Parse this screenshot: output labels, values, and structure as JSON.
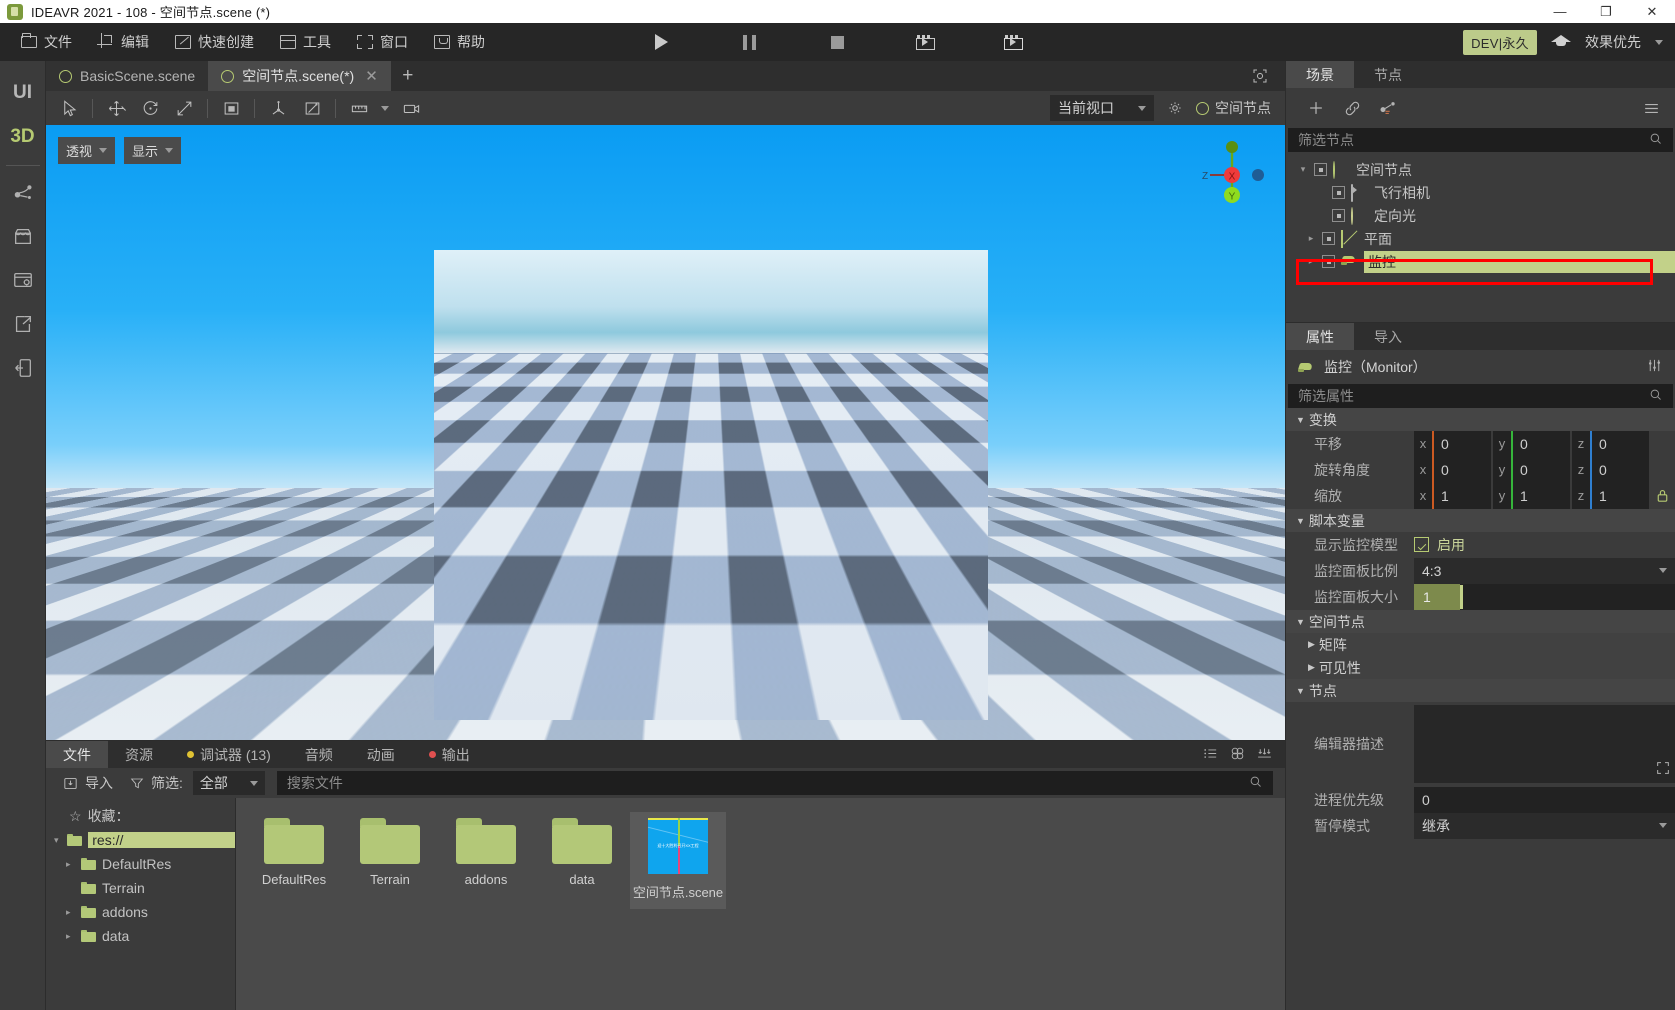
{
  "window": {
    "title": "IDEAVR 2021 - 108 - 空间节点.scene (*)",
    "minimize": "—",
    "maximize": "❐",
    "close": "✕"
  },
  "menubar": {
    "items": [
      {
        "label": "文件",
        "icon": "folder-icon"
      },
      {
        "label": "编辑",
        "icon": "crop-icon"
      },
      {
        "label": "快速创建",
        "icon": "pencil-square-icon"
      },
      {
        "label": "工具",
        "icon": "window-icon"
      },
      {
        "label": "窗口",
        "icon": "corners-icon"
      },
      {
        "label": "帮助",
        "icon": "book-icon"
      }
    ],
    "transport": [
      {
        "name": "play-button",
        "icon": "play-icon"
      },
      {
        "name": "pause-button",
        "icon": "pause-icon"
      },
      {
        "name": "stop-button",
        "icon": "stop-icon"
      },
      {
        "name": "play-scene-button",
        "icon": "film-play-icon"
      },
      {
        "name": "play-custom-scene-button",
        "icon": "film-play-alt-icon"
      }
    ],
    "dev_badge": "DEV|永久",
    "grad_cap_icon": "graduation-cap-icon",
    "render_mode": "效果优先"
  },
  "rail": {
    "modes": [
      {
        "label": "UI",
        "active": false
      },
      {
        "label": "3D",
        "active": true
      }
    ],
    "icons": [
      "node-graph-icon",
      "store-icon",
      "browser-settings-icon",
      "export-share-icon",
      "import-device-icon"
    ]
  },
  "scene_tabs": {
    "tabs": [
      {
        "label": "BasicScene.scene",
        "active": false,
        "closable": false
      },
      {
        "label": "空间节点.scene(*)",
        "active": true,
        "closable": true
      }
    ],
    "close_glyph": "✕",
    "add_glyph": "+",
    "expand_icon": "expand-viewport-icon"
  },
  "viewport_toolbar": {
    "tools": [
      {
        "name": "select-tool",
        "icon": "cursor-icon"
      },
      {
        "name": "move-tool",
        "icon": "move-icon"
      },
      {
        "name": "rotate-tool",
        "icon": "rotate-icon"
      },
      {
        "name": "scale-tool",
        "icon": "scale-icon"
      },
      {
        "name": "list-select-tool",
        "icon": "box-select-icon"
      },
      {
        "name": "local-space-tool",
        "icon": "axis-icon"
      },
      {
        "name": "snap-tool",
        "icon": "snap-icon"
      },
      {
        "name": "ruler-tool",
        "icon": "ruler-icon"
      },
      {
        "name": "camera-tool",
        "icon": "camera-icon"
      }
    ],
    "viewport_select": "当前视口",
    "settings_icon": "gear-icon",
    "node_label": "空间节点"
  },
  "viewport": {
    "perspective_label": "透视",
    "display_label": "显示",
    "gizmo": {
      "x": "X",
      "y": "Y",
      "z": "Z",
      "x_color": "#ef3b3b",
      "y_color": "#8fdb1f",
      "z_color": "#1f6fb5"
    }
  },
  "bottom_dock": {
    "tabs": [
      {
        "label": "文件",
        "active": true,
        "dot": null
      },
      {
        "label": "资源",
        "active": false,
        "dot": null
      },
      {
        "label": "调试器 (13)",
        "active": false,
        "dot": "#e0c233"
      },
      {
        "label": "音频",
        "active": false,
        "dot": null
      },
      {
        "label": "动画",
        "active": false,
        "dot": null
      },
      {
        "label": "输出",
        "active": false,
        "dot": "#e05050"
      }
    ],
    "right_icons": [
      "list-view-icon",
      "grid-view-icon",
      "download-icon"
    ],
    "toolbar": {
      "import_label": "导入",
      "import_icon": "import-icon",
      "filter_label": "筛选:",
      "filter_icon": "funnel-icon",
      "filter_value": "全部",
      "search_placeholder": "搜索文件",
      "search_icon": "search-icon"
    },
    "tree": {
      "favorites_label": "收藏：",
      "items": [
        {
          "label": "res://",
          "depth": 0,
          "arrow": "▾",
          "selected": true
        },
        {
          "label": "DefaultRes",
          "depth": 1,
          "arrow": "▸",
          "selected": false
        },
        {
          "label": "Terrain",
          "depth": 1,
          "arrow": "",
          "selected": false
        },
        {
          "label": "addons",
          "depth": 1,
          "arrow": "▸",
          "selected": false
        },
        {
          "label": "data",
          "depth": 1,
          "arrow": "▸",
          "selected": false
        }
      ]
    },
    "grid": [
      {
        "label": "DefaultRes",
        "type": "folder",
        "selected": false
      },
      {
        "label": "Terrain",
        "type": "folder",
        "selected": false
      },
      {
        "label": "addons",
        "type": "folder",
        "selected": false
      },
      {
        "label": "data",
        "type": "folder",
        "selected": false
      },
      {
        "label": "空间节点.scene",
        "type": "scene",
        "selected": true,
        "thumb_text": "迎十大胜利召开XX工程"
      }
    ]
  },
  "right_dock": {
    "tabs": [
      {
        "label": "场景",
        "active": true
      },
      {
        "label": "节点",
        "active": false
      }
    ],
    "tools": [
      {
        "name": "add-node-button",
        "icon": "plus-icon"
      },
      {
        "name": "link-scene-button",
        "icon": "link-icon"
      },
      {
        "name": "script-button",
        "icon": "script-icon"
      },
      {
        "name": "menu-button",
        "icon": "hamburger-icon"
      }
    ],
    "filter_placeholder": "筛选节点",
    "search_icon": "search-icon",
    "tree": [
      {
        "label": "空间节点",
        "depth": 0,
        "arrow": "▾",
        "icon": "sphere-icon",
        "selected": false
      },
      {
        "label": "飞行相机",
        "depth": 1,
        "arrow": "",
        "icon": "camera-icon",
        "selected": false
      },
      {
        "label": "定向光",
        "depth": 1,
        "arrow": "",
        "icon": "sun-icon",
        "selected": false
      },
      {
        "label": "平面",
        "depth": 1,
        "arrow": "▸",
        "icon": "plane-icon",
        "selected": false
      },
      {
        "label": "监控",
        "depth": 1,
        "arrow": "▸",
        "icon": "monitor-icon",
        "selected": true
      }
    ],
    "highlight_color": "#ff0000"
  },
  "properties": {
    "tabs": [
      {
        "label": "属性",
        "active": true
      },
      {
        "label": "导入",
        "active": false
      }
    ],
    "header_title": "监控（Monitor）",
    "header_icon": "monitor-icon",
    "settings_icon": "sliders-icon",
    "filter_placeholder": "筛选属性",
    "sections": [
      {
        "name": "变换",
        "expanded": true,
        "rows": [
          {
            "type": "vec3",
            "label": "平移",
            "x": "0",
            "y": "0",
            "z": "0",
            "lock": false
          },
          {
            "type": "vec3",
            "label": "旋转角度",
            "x": "0",
            "y": "0",
            "z": "0",
            "lock": false
          },
          {
            "type": "vec3",
            "label": "缩放",
            "x": "1",
            "y": "1",
            "z": "1",
            "lock": true,
            "lock_icon": "lock-icon"
          }
        ]
      },
      {
        "name": "脚本变量",
        "expanded": true,
        "rows": [
          {
            "type": "checkbox",
            "label": "显示监控模型",
            "value": "启用",
            "checked": true
          },
          {
            "type": "select",
            "label": "监控面板比例",
            "value": "4:3"
          },
          {
            "type": "slider",
            "label": "监控面板大小",
            "value": "1"
          }
        ]
      },
      {
        "name": "空间节点",
        "expanded": true,
        "rows": [
          {
            "type": "subsection",
            "label": "矩阵",
            "expanded": false
          },
          {
            "type": "subsection",
            "label": "可见性",
            "expanded": false
          }
        ]
      },
      {
        "name": "节点",
        "expanded": true,
        "rows": [
          {
            "type": "textarea",
            "label": "编辑器描述",
            "value": "",
            "expand_icon": "expand-icon"
          },
          {
            "type": "text",
            "label": "进程优先级",
            "value": "0"
          },
          {
            "type": "select",
            "label": "暂停模式",
            "value": "继承"
          }
        ]
      }
    ]
  }
}
